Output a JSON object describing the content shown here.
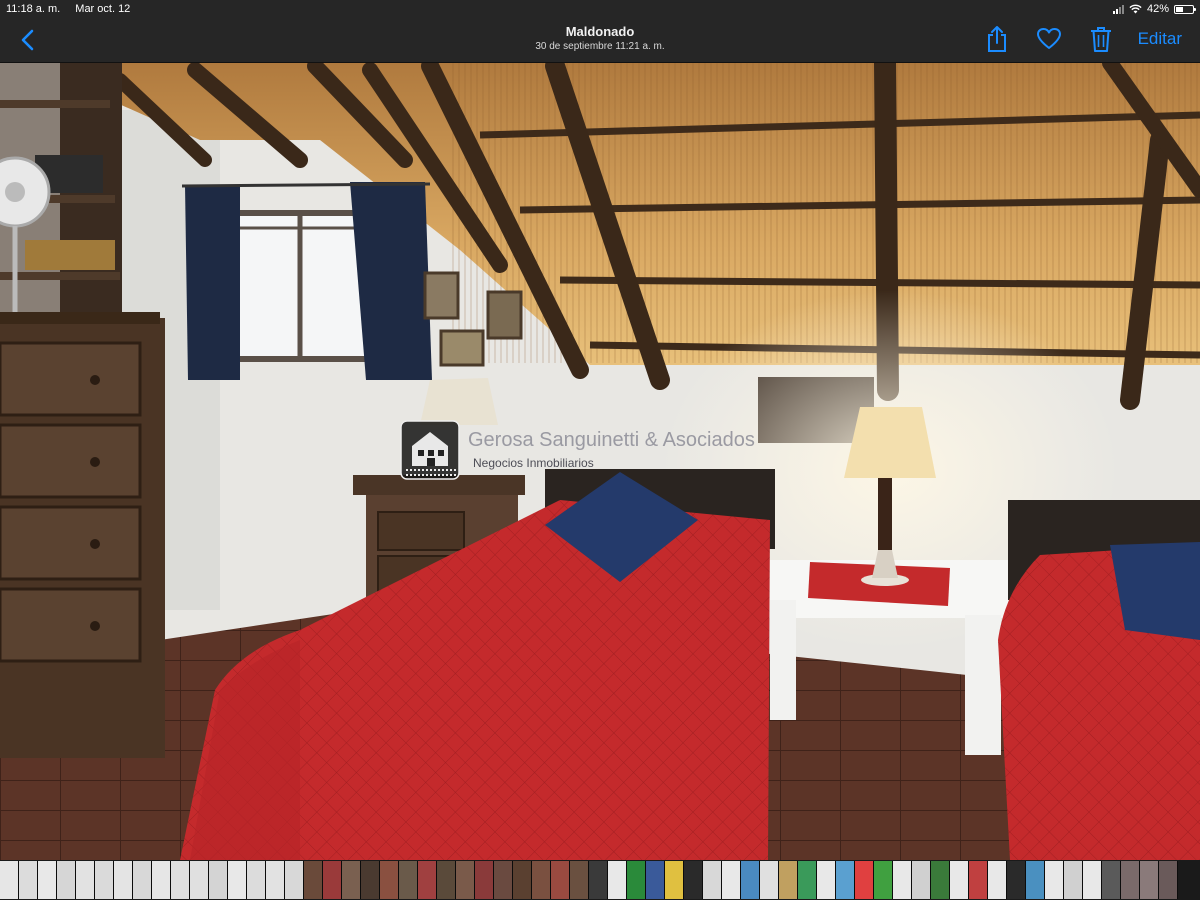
{
  "status_bar": {
    "time": "11:18 a. m.",
    "date": "Mar oct. 12",
    "battery_percent": "42%",
    "battery_level": 0.42
  },
  "navbar": {
    "title": "Maldonado",
    "subtitle": "30 de septiembre 11:21 a. m.",
    "edit_label": "Editar",
    "accent_color": "#1b8cff",
    "icons": [
      "chevron-left-icon",
      "share-icon",
      "heart-icon",
      "trash-icon"
    ]
  },
  "photo": {
    "watermark_name": "Gerosa Sanguinetti & Asociados",
    "watermark_subtitle": "Negocios Inmobiliarios",
    "scene_colors": {
      "bedspread": "#c72a2c",
      "pillow": "#243a6b",
      "thatch": "#c49050",
      "wall": "#e9e9e6",
      "wood": "#4a3524",
      "floor": "#5a3326"
    }
  },
  "thumbnails": {
    "count": 62,
    "colors": [
      "#e6e6e6",
      "#dcdcdc",
      "#e8e8e8",
      "#d6d6d6",
      "#e2e2e2",
      "#dadada",
      "#e4e4e4",
      "#d8d8d8",
      "#e6e6e6",
      "#dedede",
      "#e0e0e0",
      "#d4d4d4",
      "#e8e8e8",
      "#dcdcdc",
      "#e2e2e2",
      "#d8d8d8",
      "#6a4a3a",
      "#9a3a3a",
      "#7a6050",
      "#4a3a30",
      "#8a5040",
      "#6a5a4a",
      "#a04040",
      "#5a4a3a",
      "#7a5a4a",
      "#8a3a3a",
      "#6a4a40",
      "#5a4030",
      "#7a5040",
      "#9a4a40",
      "#6a5040",
      "#3a3a3a",
      "#e8e8e8",
      "#2a8a3a",
      "#3a5a9a",
      "#e0c040",
      "#2a2a2a",
      "#d8d8d8",
      "#e8e8e8",
      "#4a8ac0",
      "#e0e0e0",
      "#c0a060",
      "#3a9a5a",
      "#e8e8e8",
      "#5aa0d0",
      "#e04040",
      "#40a040",
      "#e8e8e8",
      "#d0d0d0",
      "#3a7a3a",
      "#e8e8e8",
      "#c04040",
      "#e8e8e8",
      "#2a2a2a",
      "#4a90c0",
      "#e8e8e8",
      "#d0d0d0",
      "#e8e8e8",
      "#5a5a5a",
      "#7a6a6a",
      "#8a7a7a",
      "#6a5a5a"
    ]
  }
}
